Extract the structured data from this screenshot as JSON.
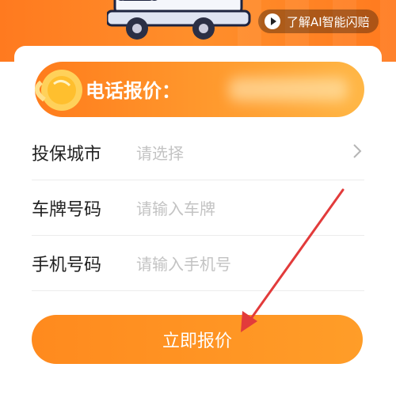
{
  "ai_button": {
    "label": "了解AI智能闪赔",
    "icon": "play-icon"
  },
  "banner": {
    "title": "电话报价："
  },
  "form": {
    "rows": [
      {
        "label": "投保城市",
        "placeholder": "请选择",
        "icon": "chevron-right-icon"
      },
      {
        "label": "车牌号码",
        "placeholder": "请输入车牌"
      },
      {
        "label": "手机号码",
        "placeholder": "请输入手机号"
      }
    ],
    "submit_label": "立即报价"
  },
  "colors": {
    "accent": "#ff8a1e",
    "arrow": "#e23b3b",
    "placeholder": "#c3c3c3"
  }
}
